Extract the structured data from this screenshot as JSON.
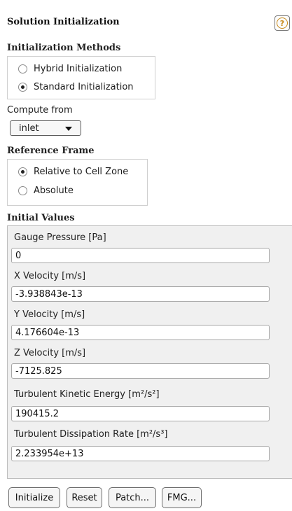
{
  "panel": {
    "title": "Solution Initialization",
    "help_icon": "help-icon",
    "help_glyph": "?"
  },
  "methods": {
    "label": "Initialization Methods",
    "options": [
      "Hybrid  Initialization",
      "Standard Initialization"
    ],
    "selected": "Standard Initialization"
  },
  "compute_from": {
    "label": "Compute from",
    "value": "inlet"
  },
  "reference_frame": {
    "label": "Reference Frame",
    "options": [
      "Relative to Cell Zone",
      "Absolute"
    ],
    "selected": "Relative to Cell Zone"
  },
  "initial_values": {
    "label": "Initial Values",
    "fields": [
      {
        "label": "Gauge Pressure [Pa]",
        "value": "0"
      },
      {
        "label": "X Velocity [m/s]",
        "value": "-3.938843e-13"
      },
      {
        "label": "Y Velocity [m/s]",
        "value": "4.176604e-13"
      },
      {
        "label": "Z Velocity [m/s]",
        "value": "-7125.825"
      },
      {
        "label": "Turbulent Kinetic Energy [m²/s²]",
        "value": "190415.2"
      },
      {
        "label": "Turbulent Dissipation Rate [m²/s³]",
        "value": "2.233954e+13"
      }
    ]
  },
  "buttons": {
    "initialize": "Initialize",
    "reset": "Reset",
    "patch": "Patch...",
    "fmg": "FMG..."
  }
}
